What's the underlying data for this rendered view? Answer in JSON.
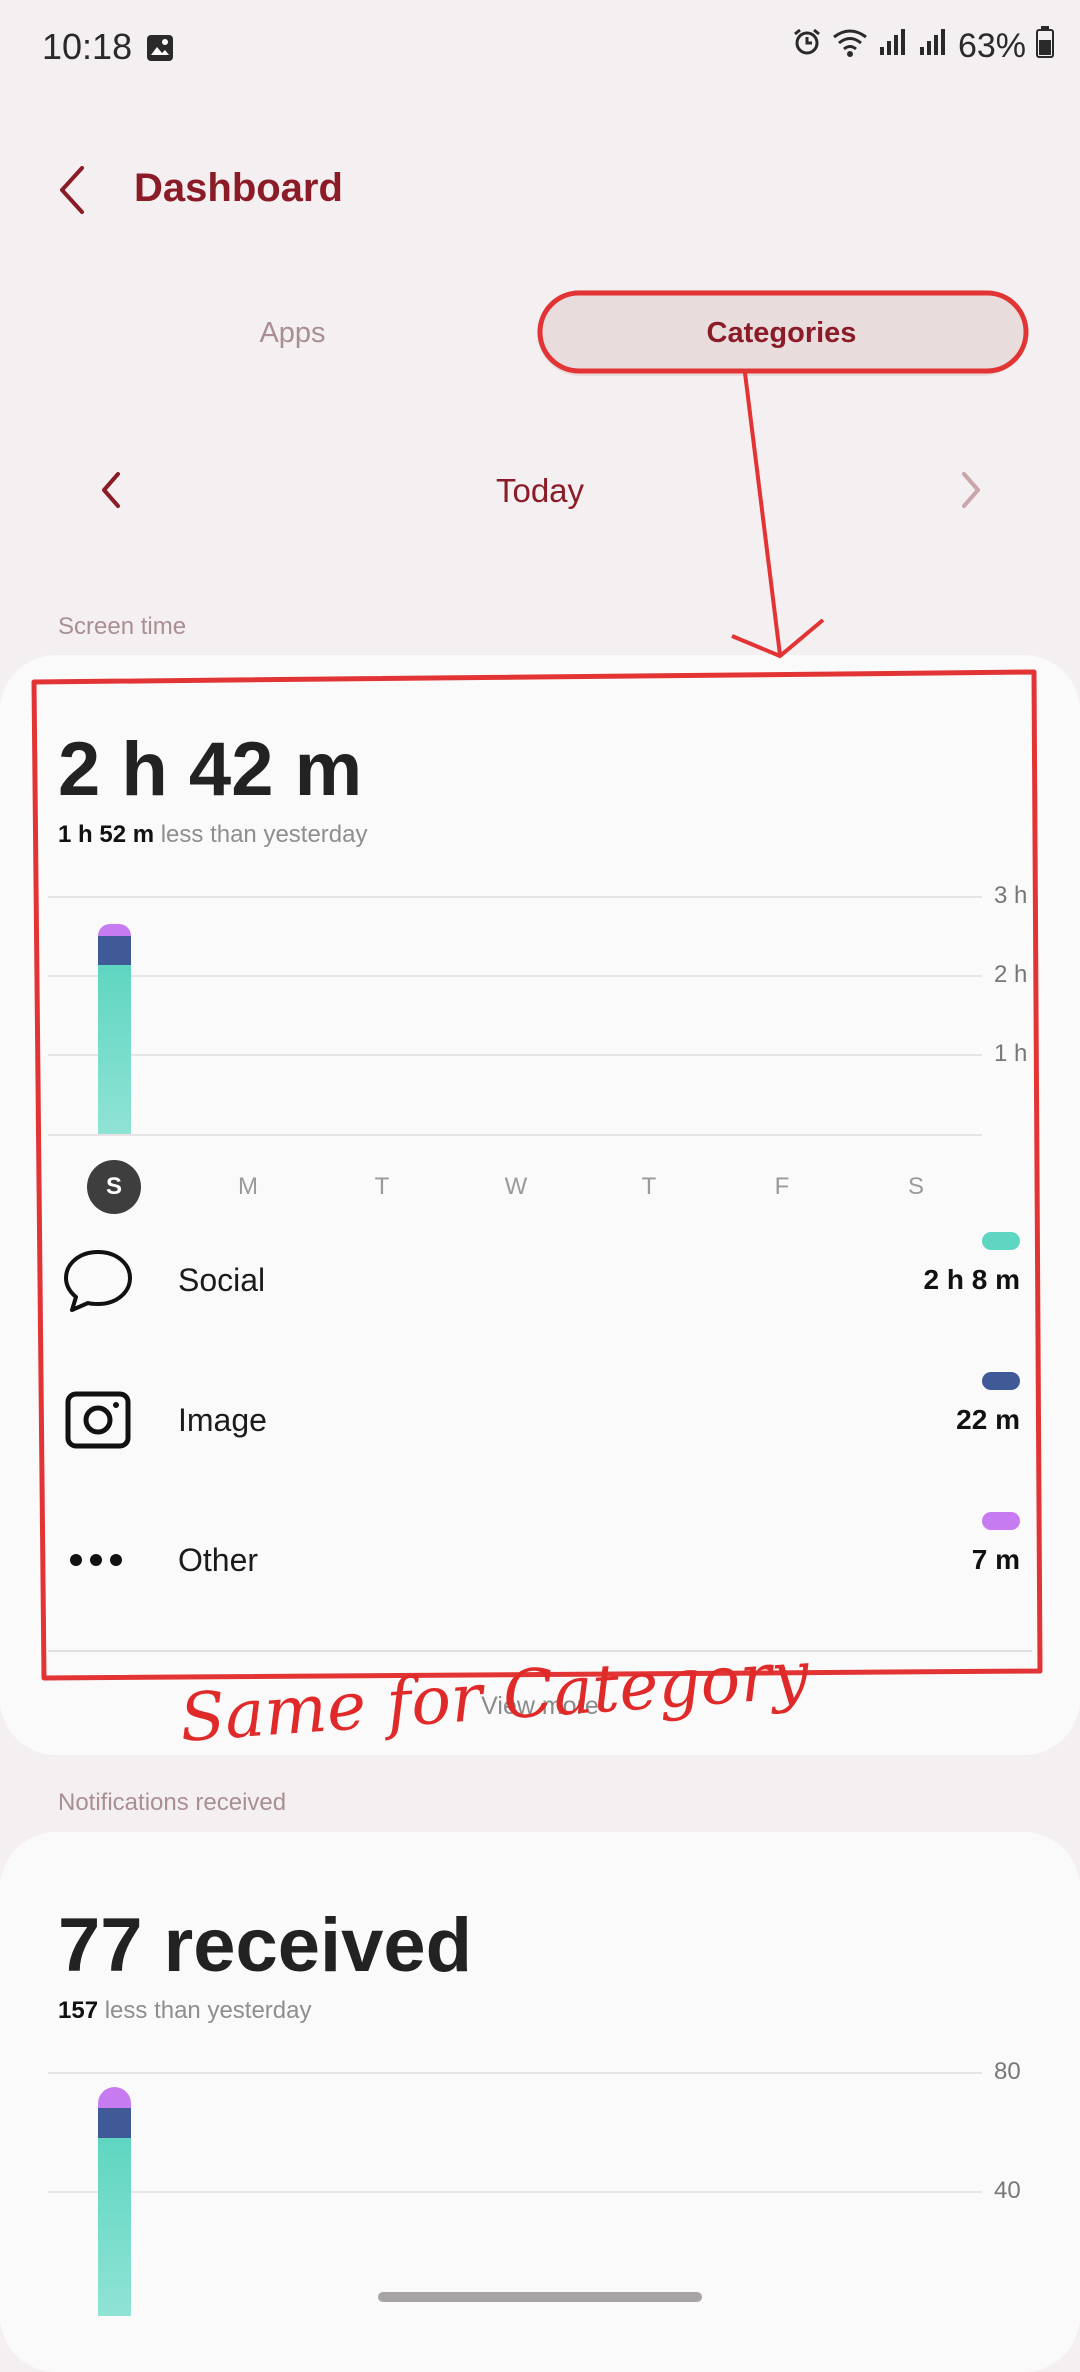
{
  "status_bar": {
    "time": "10:18",
    "battery": "63%"
  },
  "header": {
    "title": "Dashboard"
  },
  "tabs": [
    {
      "label": "Apps",
      "active": false
    },
    {
      "label": "Categories",
      "active": true
    }
  ],
  "date_nav": {
    "label": "Today"
  },
  "screen_time": {
    "section_label": "Screen time",
    "total": "2 h 42 m",
    "compare_value": "1 h 52 m",
    "compare_text": " less than yesterday",
    "y_ticks": [
      "3 h",
      "2 h",
      "1 h"
    ],
    "days": [
      "S",
      "M",
      "T",
      "W",
      "T",
      "F",
      "S"
    ],
    "active_day": 0,
    "categories": [
      {
        "name": "Social",
        "value": "2 h 8 m",
        "icon": "chat-bubble-icon",
        "color": "#5fd6c1"
      },
      {
        "name": "Image",
        "value": "22 m",
        "icon": "image-icon",
        "color": "#3f5a96"
      },
      {
        "name": "Other",
        "value": "7 m",
        "icon": "more-dots-icon",
        "color": "#c77bf0"
      }
    ],
    "view_more": "View more"
  },
  "notifications": {
    "section_label": "Notifications received",
    "total": "77 received",
    "compare_value": "157",
    "compare_text": " less than yesterday",
    "y_ticks": [
      "80",
      "40"
    ]
  },
  "chart_data": [
    {
      "type": "bar",
      "categories": [
        "S",
        "M",
        "T",
        "W",
        "T",
        "F",
        "S"
      ],
      "series": [
        {
          "name": "Social",
          "values": [
            128,
            0,
            0,
            0,
            0,
            0,
            0
          ]
        },
        {
          "name": "Image",
          "values": [
            22,
            0,
            0,
            0,
            0,
            0,
            0
          ]
        },
        {
          "name": "Other",
          "values": [
            7,
            0,
            0,
            0,
            0,
            0,
            0
          ]
        }
      ],
      "ylim": [
        0,
        180
      ],
      "y_ticks": [
        "3 h",
        "2 h",
        "1 h"
      ],
      "stacked": true
    },
    {
      "type": "bar",
      "categories": [
        "S"
      ],
      "series": [
        {
          "name": "Social",
          "values": [
            60
          ]
        },
        {
          "name": "Image",
          "values": [
            10
          ]
        },
        {
          "name": "Other",
          "values": [
            7
          ]
        }
      ],
      "y_ticks": [
        "80",
        "40"
      ],
      "stacked": true
    }
  ],
  "annotation": {
    "text": "Same for Category",
    "color": "#e02a2a"
  },
  "colors": {
    "brand": "#8b1c27",
    "social": "#5fd6c1",
    "image": "#3f5a96",
    "other": "#c77bf0"
  }
}
